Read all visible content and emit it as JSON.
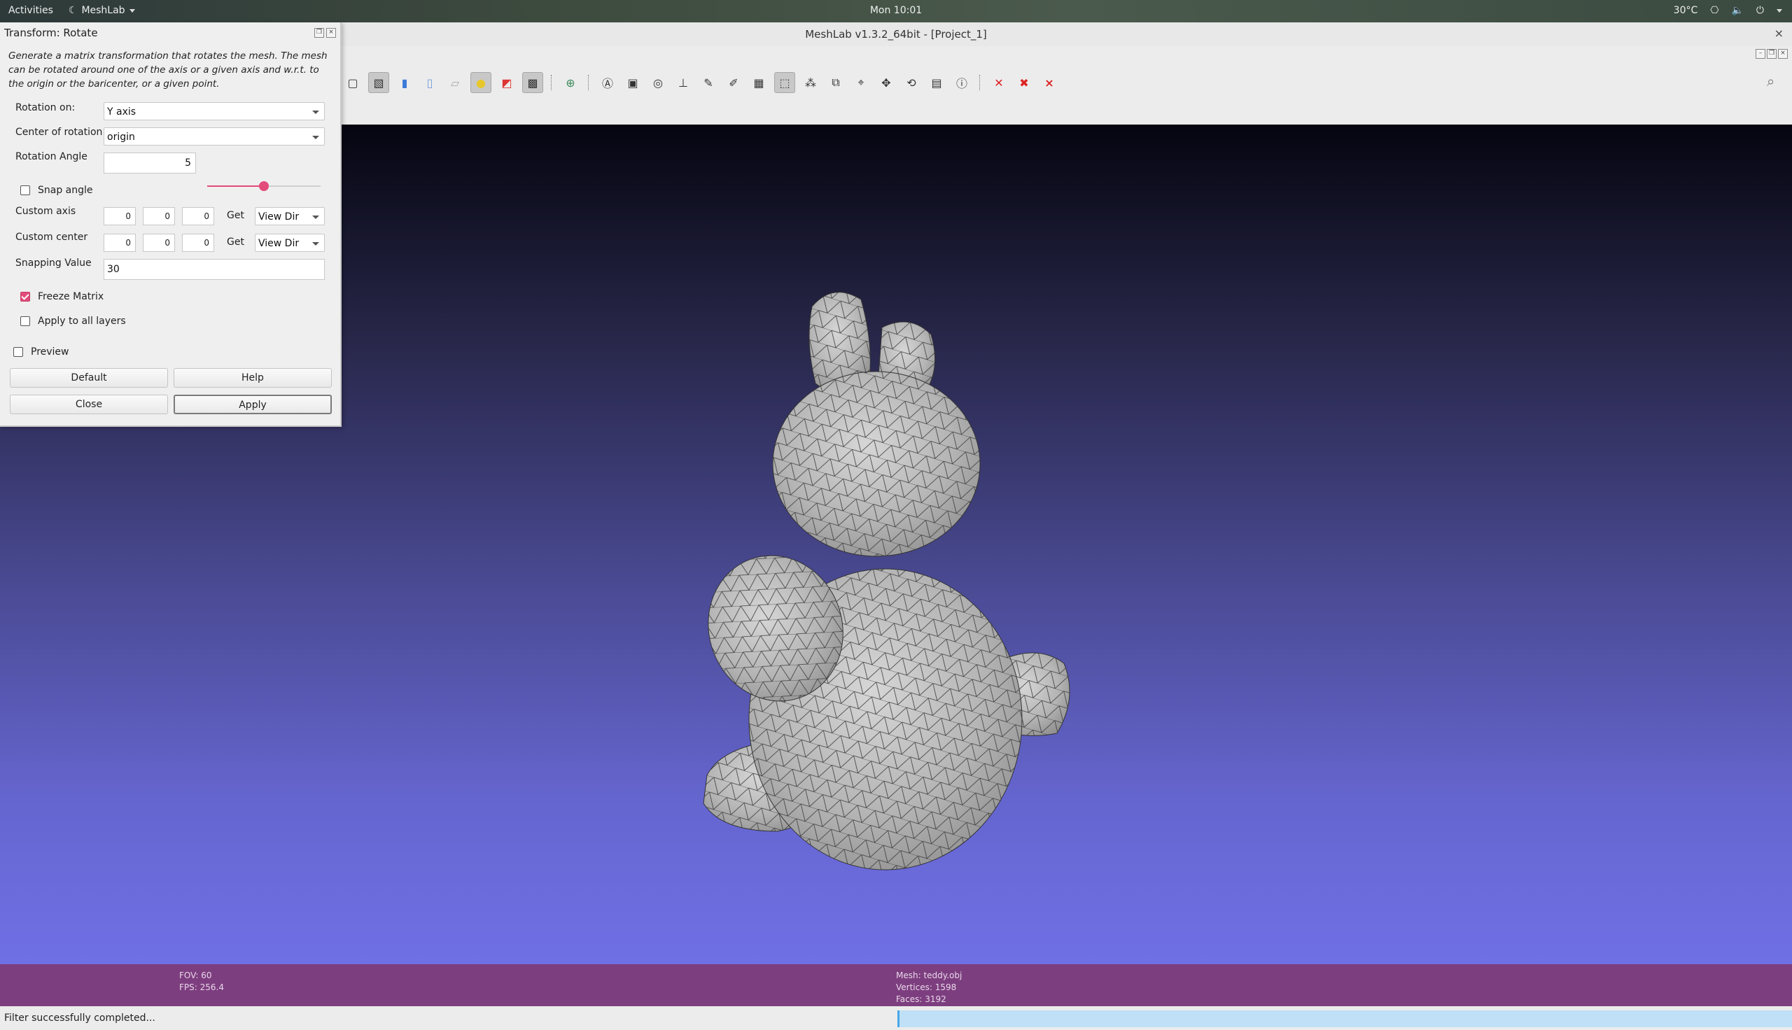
{
  "topbar": {
    "activities": "Activities",
    "app_name": "MeshLab",
    "clock": "Mon 10:01",
    "temperature": "30°C"
  },
  "window": {
    "title": "MeshLab v1.3.2_64bit - [Project_1]",
    "close_glyph": "×"
  },
  "toolbar": {
    "icons": [
      "box-icon",
      "wireframe-icon",
      "points-icon",
      "flat-icon",
      "smooth-icon",
      "texture-icon",
      "light-icon",
      "color-icon",
      "select-icon",
      "globe-icon",
      "annotation-icon",
      "measure-icon",
      "mesh-icon",
      "axes-icon",
      "pen-icon",
      "paint-icon",
      "layers-icon",
      "select-faces-icon",
      "select-vertices-icon",
      "align-icon",
      "pick-icon",
      "move-icon",
      "rotate-icon",
      "raster-icon",
      "info-icon",
      "delete-face-icon",
      "delete-vertex-icon",
      "delete-all-icon"
    ]
  },
  "dialog": {
    "title": "Transform: Rotate",
    "description": "Generate a matrix transformation that rotates the mesh. The mesh can be rotated around one of the axis or a given axis and w.r.t. to the origin or the baricenter, or a given point.",
    "rotation_on_label": "Rotation on:",
    "rotation_on_value": "Y axis",
    "center_label": "Center of rotation:",
    "center_value": "origin",
    "angle_label": "Rotation Angle",
    "angle_value": "5",
    "angle_slider_fraction": 0.5,
    "snap_angle_label": "Snap angle",
    "snap_angle_checked": false,
    "custom_axis_label": "Custom axis",
    "custom_axis": [
      "0",
      "0",
      "0"
    ],
    "custom_center_label": "Custom center",
    "custom_center": [
      "0",
      "0",
      "0"
    ],
    "get_label": "Get",
    "view_dir": "View Dir",
    "snapping_value_label": "Snapping Value",
    "snapping_value": "30",
    "freeze_matrix_label": "Freeze Matrix",
    "freeze_matrix_checked": true,
    "apply_all_label": "Apply to all layers",
    "apply_all_checked": false,
    "preview_label": "Preview",
    "preview_checked": false,
    "default_button": "Default",
    "help_button": "Help",
    "close_button": "Close",
    "apply_button": "Apply"
  },
  "info": {
    "fov": "FOV: 60",
    "fps": "FPS:   256.4",
    "mesh": "Mesh: teddy.obj",
    "vertices": "Vertices: 1598",
    "faces": "Faces: 3192"
  },
  "status": {
    "message": "Filter successfully completed..."
  },
  "colors": {
    "accent": "#e24b7a",
    "info_bar": "#7d3e7f",
    "progress": "#bfe0f6"
  }
}
